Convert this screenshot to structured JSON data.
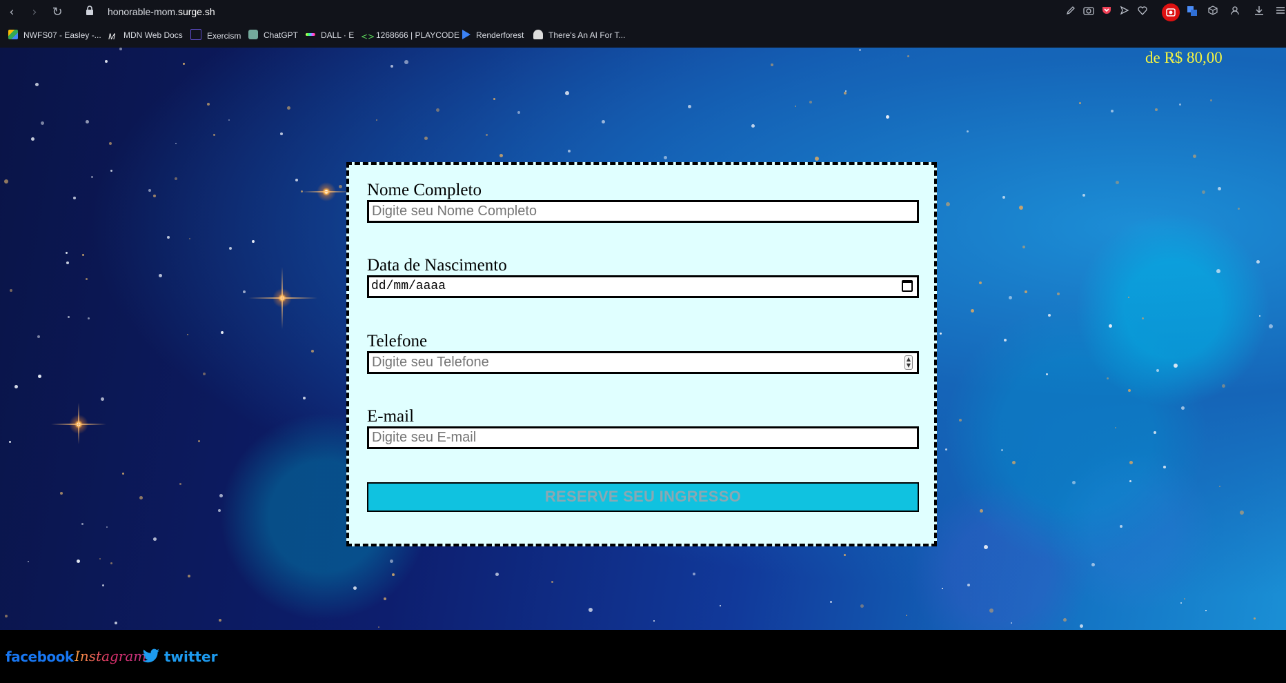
{
  "browser": {
    "url_prefix": "honorable-mom.",
    "url_domain": "surge.sh",
    "nav": {
      "back": "‹",
      "forward": "›",
      "reload": "↻"
    },
    "extensions": [
      "edit-icon",
      "camera-icon",
      "pocket-icon",
      "send-icon",
      "heart-icon",
      "record-icon",
      "translate-icon",
      "cube-icon",
      "profile-icon",
      "download-icon",
      "menu-icon"
    ],
    "bookmarks": [
      {
        "label": "NWFS07 - Easley -...",
        "color": "#fbbc04"
      },
      {
        "label": "MDN Web Docs",
        "color": "#ffffff"
      },
      {
        "label": "Exercism",
        "color": "#604fcd"
      },
      {
        "label": "ChatGPT",
        "color": "#74aa9c"
      },
      {
        "label": "DALL · E",
        "color": "#e8e84a"
      },
      {
        "label": "1268666 | PLAYCODE",
        "color": "#5bd35b"
      },
      {
        "label": "Renderforest",
        "color": "#3b82f6"
      },
      {
        "label": "There's An AI For T...",
        "color": "#dddddd"
      }
    ]
  },
  "page": {
    "price": "de R$ 80,00",
    "form": {
      "name_label": "Nome Completo",
      "name_placeholder": "Digite seu Nome Completo",
      "birth_label": "Data de Nascimento",
      "birth_value": "dd/mm/aaaa",
      "phone_label": "Telefone",
      "phone_placeholder": "Digite seu Telefone",
      "email_label": "E-mail",
      "email_placeholder": "Digite seu E-mail",
      "submit_label": "RESERVE SEU INGRESSO"
    },
    "footer": {
      "facebook": "facebook",
      "instagram": "Instagram",
      "twitter": "twitter"
    }
  }
}
